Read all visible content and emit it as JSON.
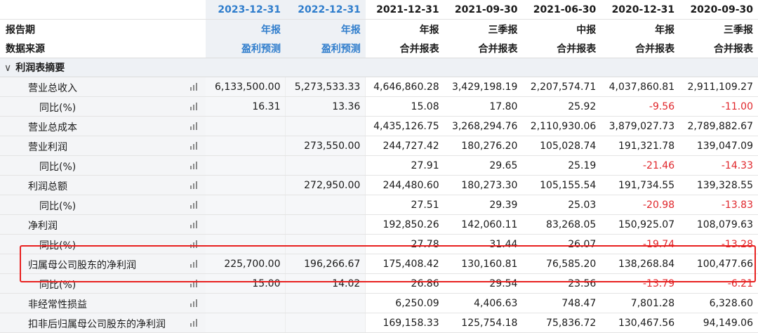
{
  "header": {
    "row_labels": [
      "报告期",
      "数据来源"
    ],
    "dates": [
      "2023-12-31",
      "2022-12-31",
      "2021-12-31",
      "2021-09-30",
      "2021-06-30",
      "2020-12-31",
      "2020-09-30"
    ],
    "report_types": [
      "年报",
      "年报",
      "年报",
      "三季报",
      "中报",
      "年报",
      "三季报"
    ],
    "sources": [
      "盈利预测",
      "盈利预测",
      "合并报表",
      "合并报表",
      "合并报表",
      "合并报表",
      "合并报表"
    ]
  },
  "section": {
    "title": "利润表摘要",
    "toggle_icon": "chevron-down-icon"
  },
  "rows": [
    {
      "name": "营业总收入",
      "sub": false,
      "values": [
        "6,133,500.00",
        "5,273,533.33",
        "4,646,860.28",
        "3,429,198.19",
        "2,207,574.71",
        "4,037,860.81",
        "2,911,109.27"
      ]
    },
    {
      "name": "同比(%)",
      "sub": true,
      "values": [
        "16.31",
        "13.36",
        "15.08",
        "17.80",
        "25.92",
        "-9.56",
        "-11.00"
      ]
    },
    {
      "name": "营业总成本",
      "sub": false,
      "values": [
        "",
        "",
        "4,435,126.75",
        "3,268,294.76",
        "2,110,930.06",
        "3,879,027.73",
        "2,789,882.67"
      ]
    },
    {
      "name": "营业利润",
      "sub": false,
      "values": [
        "",
        "273,550.00",
        "244,727.42",
        "180,276.20",
        "105,028.74",
        "191,321.78",
        "139,047.09"
      ]
    },
    {
      "name": "同比(%)",
      "sub": true,
      "values": [
        "",
        "",
        "27.91",
        "29.65",
        "25.19",
        "-21.46",
        "-14.33"
      ]
    },
    {
      "name": "利润总额",
      "sub": false,
      "values": [
        "",
        "272,950.00",
        "244,480.60",
        "180,273.30",
        "105,155.54",
        "191,734.55",
        "139,328.55"
      ]
    },
    {
      "name": "同比(%)",
      "sub": true,
      "values": [
        "",
        "",
        "27.51",
        "29.39",
        "25.03",
        "-20.98",
        "-13.83"
      ]
    },
    {
      "name": "净利润",
      "sub": false,
      "values": [
        "",
        "",
        "192,850.26",
        "142,060.11",
        "83,268.05",
        "150,925.07",
        "108,079.63"
      ]
    },
    {
      "name": "同比(%)",
      "sub": true,
      "values": [
        "",
        "",
        "27.78",
        "31.44",
        "26.07",
        "-19.74",
        "-13.28"
      ]
    },
    {
      "name": "归属母公司股东的净利润",
      "sub": false,
      "values": [
        "225,700.00",
        "196,266.67",
        "175,408.42",
        "130,160.81",
        "76,585.20",
        "138,268.84",
        "100,477.66"
      ]
    },
    {
      "name": "同比(%)",
      "sub": true,
      "values": [
        "15.00",
        "14.02",
        "26.86",
        "29.54",
        "23.56",
        "-13.79",
        "-6.21"
      ]
    },
    {
      "name": "非经常性损益",
      "sub": false,
      "values": [
        "",
        "",
        "6,250.09",
        "4,406.63",
        "748.47",
        "7,801.28",
        "6,328.60"
      ]
    },
    {
      "name": "扣非后归属母公司股东的净利润",
      "sub": false,
      "values": [
        "",
        "",
        "169,158.33",
        "125,754.18",
        "75,836.72",
        "130,467.56",
        "94,149.06"
      ]
    }
  ],
  "colors": {
    "forecast_blue": "#2f7dcc",
    "negative_red": "#e0262b",
    "highlight_border": "#e8201f"
  },
  "row_icon": "bar-chart-icon"
}
